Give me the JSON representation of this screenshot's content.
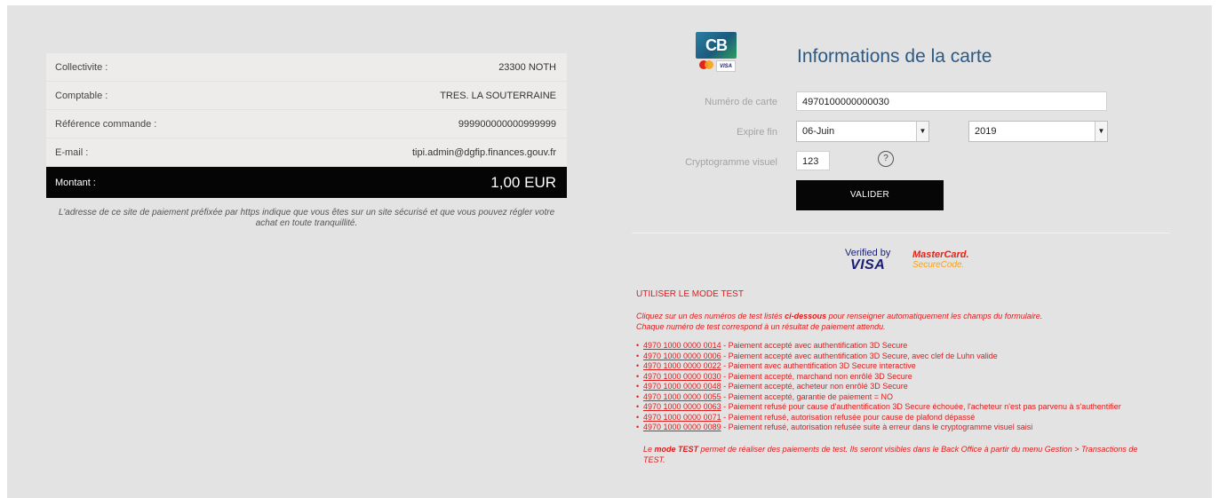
{
  "summary": {
    "rows": [
      {
        "label": "Collectivite :",
        "value": "23300 NOTH"
      },
      {
        "label": "Comptable :",
        "value": "TRES. LA SOUTERRAINE"
      },
      {
        "label": "Référence commande :",
        "value": "999900000000999999"
      },
      {
        "label": "E-mail :",
        "value": "tipi.admin@dgfip.finances.gouv.fr"
      }
    ],
    "total_label": "Montant :",
    "total_value": "1,00 EUR",
    "secure_note": "L'adresse de ce site de paiement préfixée par https indique que vous êtes sur un site sécurisé et que vous pouvez régler votre achat en toute tranquillité."
  },
  "form": {
    "logo_text": "CB",
    "logo_visa": "VISA",
    "title": "Informations de la carte",
    "card_number_label": "Numéro de carte",
    "card_number_value": "4970100000000030",
    "expiry_label": "Expire fin",
    "expiry_month": "06-Juin",
    "expiry_year": "2019",
    "cvv_label": "Cryptogramme visuel",
    "cvv_value": "123",
    "help_symbol": "?",
    "submit_label": "VALIDER"
  },
  "badges": {
    "verified_by": "Verified by",
    "visa": "VISA",
    "mastercard": "MasterCard.",
    "securecode": "SecureCode."
  },
  "test_mode": {
    "title": "UTILISER LE MODE TEST",
    "intro_line1_a": "Cliquez sur un des numéros de test listés ",
    "intro_line1_bold": "ci-dessous",
    "intro_line1_b": " pour renseigner automatiquement les champs du formulaire.",
    "intro_line2": "Chaque numéro de test correspond à un résultat de paiement attendu.",
    "items": [
      {
        "number": "4970 1000 0000 0014",
        "desc": " - Paiement accepté avec authentification 3D Secure"
      },
      {
        "number": "4970 1000 0000 0006",
        "desc": " - Paiement accepté avec authentification 3D Secure, avec clef de Luhn valide"
      },
      {
        "number": "4970 1000 0000 0022",
        "desc": " - Paiement avec authentification 3D Secure interactive"
      },
      {
        "number": "4970 1000 0000 0030",
        "desc": " - Paiement accepté, marchand non enrôlé 3D Secure"
      },
      {
        "number": "4970 1000 0000 0048",
        "desc": " - Paiement accepté, acheteur non enrôlé 3D Secure"
      },
      {
        "number": "4970 1000 0000 0055",
        "desc": " - Paiement accepté, garantie de paiement = NO"
      },
      {
        "number": "4970 1000 0000 0063",
        "desc": " - Paiement refusé pour cause d'authentification 3D Secure échouée, l'acheteur n'est pas parvenu à s'authentifier"
      },
      {
        "number": "4970 1000 0000 0071",
        "desc": " - Paiement refusé, autorisation refusée pour cause de plafond dépassé"
      },
      {
        "number": "4970 1000 0000 0089",
        "desc": " - Paiement refusé, autorisation refusée suite à erreur dans le cryptogramme visuel saisi"
      }
    ],
    "footer_a": "Le ",
    "footer_bold": "mode TEST",
    "footer_b": " permet de réaliser des paiements de test. Ils seront visibles dans le Back Office à partir du menu Gestion > Transactions de TEST."
  }
}
